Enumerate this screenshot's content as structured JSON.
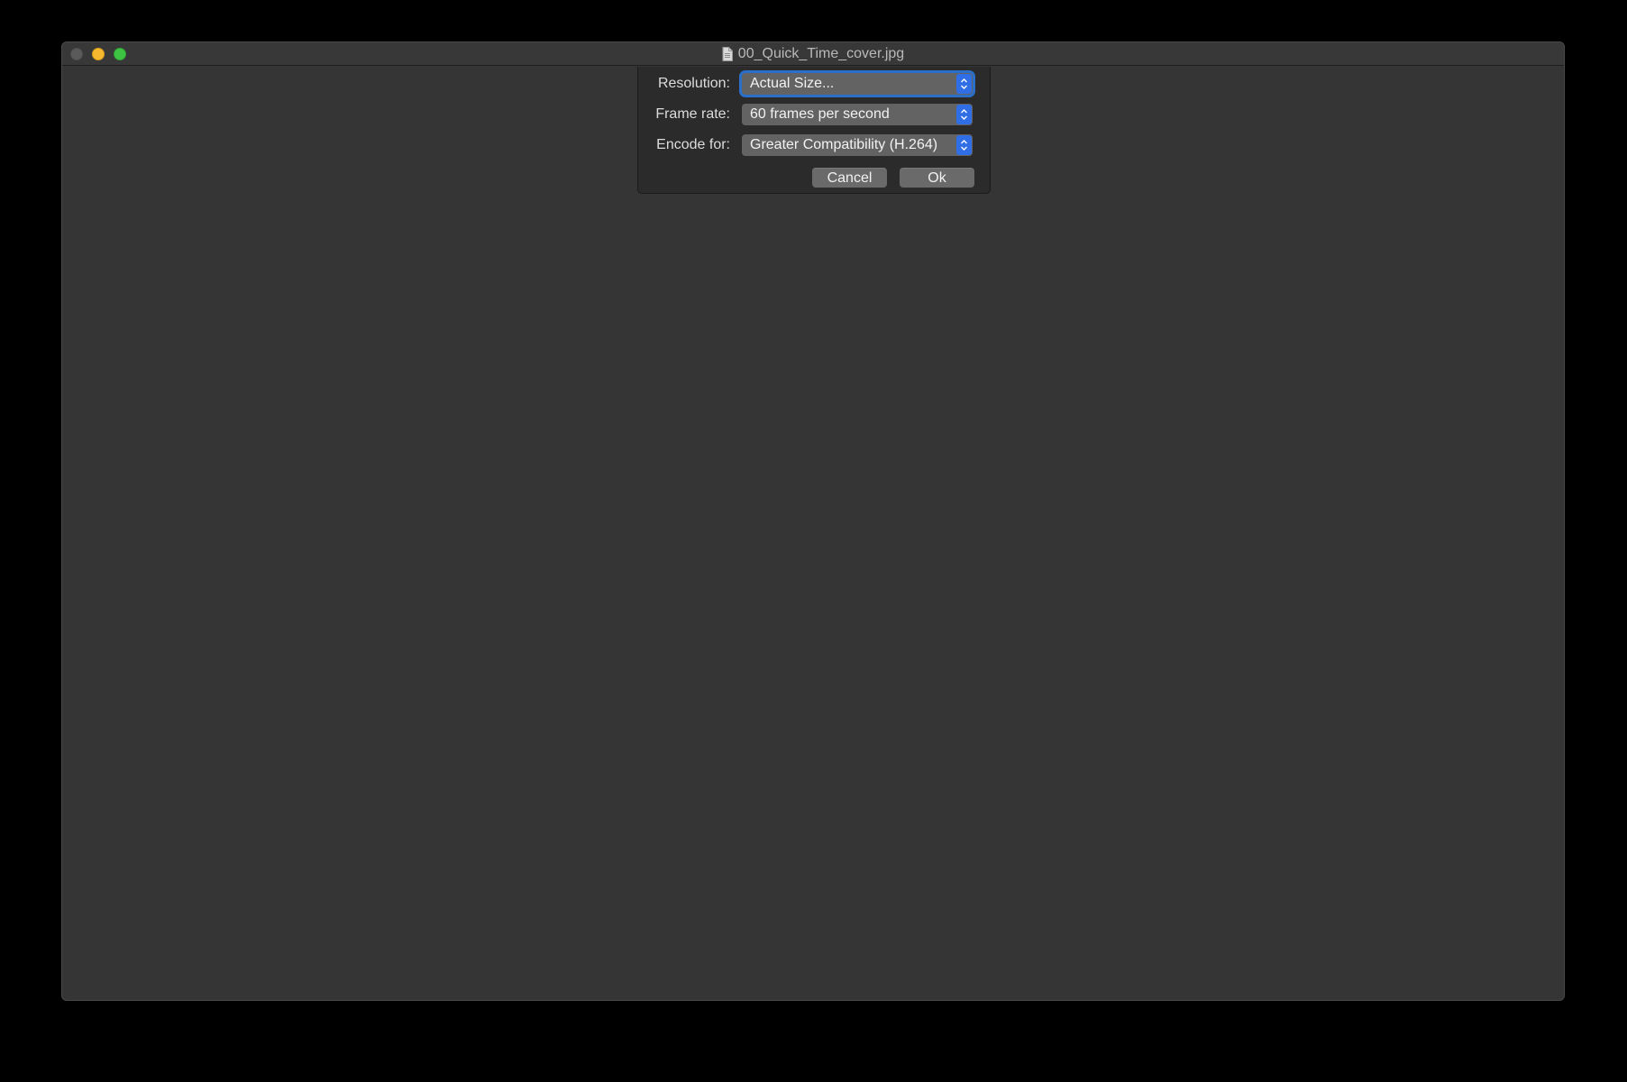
{
  "window": {
    "title": "00_Quick_Time_cover.jpg",
    "title_icon": "document-icon"
  },
  "dialog": {
    "rows": [
      {
        "label": "Resolution:",
        "value": "Actual Size..."
      },
      {
        "label": "Frame rate:",
        "value": "60 frames per second"
      },
      {
        "label": "Encode for:",
        "value": "Greater Compatibility (H.264)"
      }
    ],
    "cancel_label": "Cancel",
    "ok_label": "Ok"
  },
  "colors": {
    "accent": "#2f6ee5",
    "focus_ring": "#2a6fc9",
    "window_bg": "#353535"
  }
}
